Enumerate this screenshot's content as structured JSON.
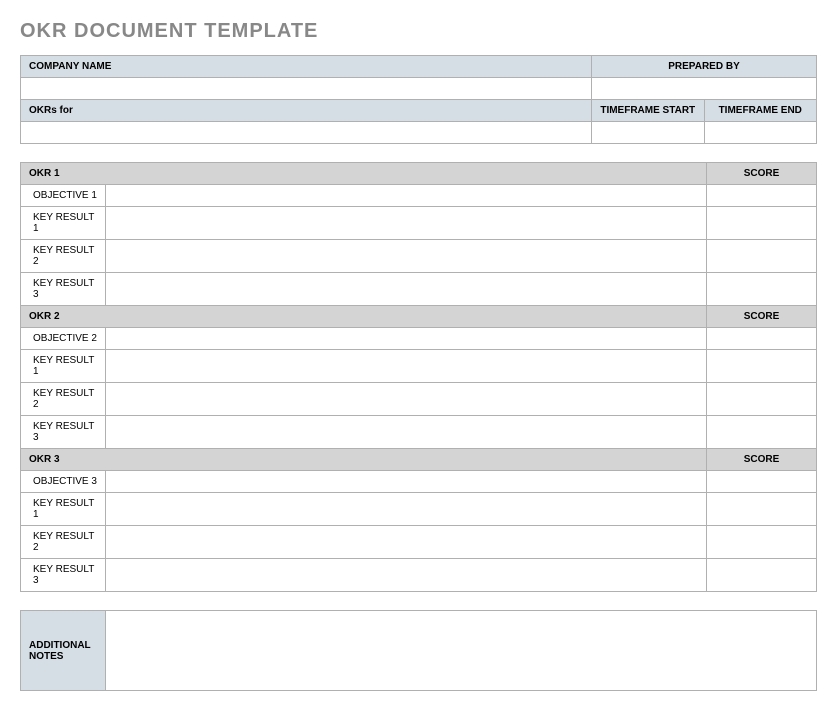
{
  "title": "OKR DOCUMENT TEMPLATE",
  "top": {
    "company_label": "COMPANY NAME",
    "prepared_label": "PREPARED BY",
    "company_value": "",
    "prepared_value": "",
    "okrsfor_label": "OKRs for",
    "timeframe_start_label": "TIMEFRAME START",
    "timeframe_end_label": "TIMEFRAME END",
    "okrsfor_value": "",
    "timeframe_start_value": "",
    "timeframe_end_value": ""
  },
  "okrs": {
    "0": {
      "header": "OKR 1",
      "score_label": "SCORE",
      "objective_label": "OBJECTIVE 1",
      "kr1_label": "KEY RESULT 1",
      "kr2_label": "KEY RESULT 2",
      "kr3_label": "KEY RESULT 3",
      "objective_value": "",
      "kr1_value": "",
      "kr2_value": "",
      "kr3_value": "",
      "score_value": "",
      "kr1_score": "",
      "kr2_score": "",
      "kr3_score": ""
    },
    "1": {
      "header": "OKR 2",
      "score_label": "SCORE",
      "objective_label": "OBJECTIVE 2",
      "kr1_label": "KEY RESULT 1",
      "kr2_label": "KEY RESULT 2",
      "kr3_label": "KEY RESULT 3",
      "objective_value": "",
      "kr1_value": "",
      "kr2_value": "",
      "kr3_value": "",
      "score_value": "",
      "kr1_score": "",
      "kr2_score": "",
      "kr3_score": ""
    },
    "2": {
      "header": "OKR 3",
      "score_label": "SCORE",
      "objective_label": "OBJECTIVE 3",
      "kr1_label": "KEY RESULT 1",
      "kr2_label": "KEY RESULT 2",
      "kr3_label": "KEY RESULT 3",
      "objective_value": "",
      "kr1_value": "",
      "kr2_value": "",
      "kr3_value": "",
      "score_value": "",
      "kr1_score": "",
      "kr2_score": "",
      "kr3_score": ""
    }
  },
  "notes": {
    "label": "ADDITIONAL NOTES",
    "value": ""
  }
}
